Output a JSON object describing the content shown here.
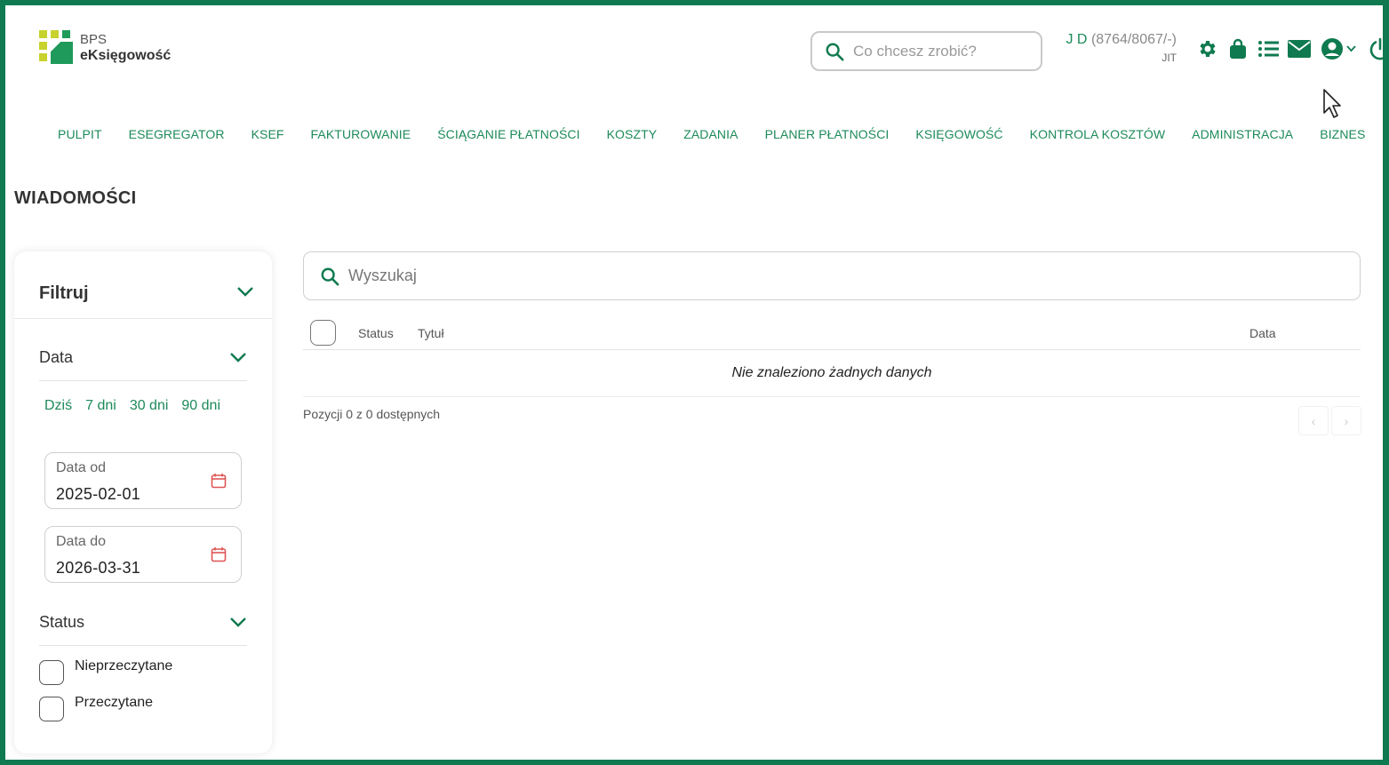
{
  "brand": {
    "line1": "BPS",
    "line2": "eKsięgowość"
  },
  "header": {
    "search_placeholder": "Co chcesz zrobić?",
    "user_name": "J D",
    "user_code": "(8764/8067/-)",
    "user_sub": "JIT",
    "icons": [
      "gear-icon",
      "bag-icon",
      "list-icon",
      "mail-icon",
      "user-circle-icon",
      "chevron-down-icon",
      "power-icon"
    ]
  },
  "nav": [
    "PULPIT",
    "ESEGREGATOR",
    "KSEF",
    "FAKTUROWANIE",
    "ŚCIĄGANIE PŁATNOŚCI",
    "KOSZTY",
    "ZADANIA",
    "PLANER PŁATNOŚCI",
    "KSIĘGOWOŚĆ",
    "KONTROLA KOSZTÓW",
    "ADMINISTRACJA",
    "BIZNES"
  ],
  "page_title": "WIADOMOŚCI",
  "filter": {
    "title": "Filtruj",
    "date_section": "Data",
    "quick_ranges": [
      "Dziś",
      "7 dni",
      "30 dni",
      "90 dni"
    ],
    "date_from_label": "Data od",
    "date_from_value": "2025-02-01",
    "date_to_label": "Data do",
    "date_to_value": "2026-03-31",
    "status_section": "Status",
    "status_options": [
      "Nieprzeczytane",
      "Przeczytane"
    ]
  },
  "main": {
    "search_placeholder": "Wyszukaj",
    "columns": {
      "status": "Status",
      "title": "Tytuł",
      "date": "Data"
    },
    "empty_text": "Nie znaleziono żadnych danych",
    "pagination_info": "Pozycji 0 z 0 dostępnych",
    "prev": "‹",
    "next": "›"
  },
  "colors": {
    "accent": "#0f7a4f",
    "nav_text": "#1d8a5a",
    "logo_yellow": "#c8d22c",
    "logo_green": "#1f9a5a",
    "calendar_red": "#e05555"
  }
}
